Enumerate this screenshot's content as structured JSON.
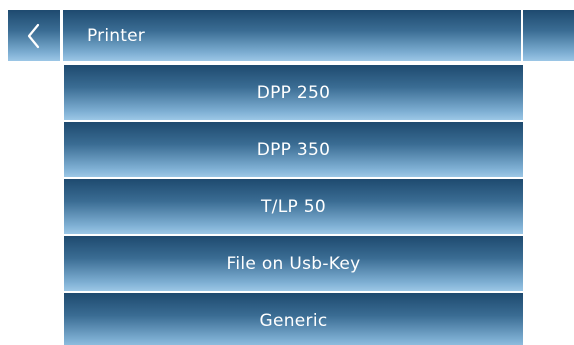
{
  "header": {
    "title": "Printer",
    "back_icon": "chevron-left-icon"
  },
  "menu": {
    "items": [
      {
        "label": "DPP 250"
      },
      {
        "label": "DPP 350"
      },
      {
        "label": "T/LP 50"
      },
      {
        "label": "File on Usb-Key"
      },
      {
        "label": "Generic"
      }
    ]
  },
  "colors": {
    "gradient_top": "#1e4a6f",
    "gradient_bottom": "#9cc7e6",
    "text": "#ffffff",
    "background": "#ffffff"
  }
}
